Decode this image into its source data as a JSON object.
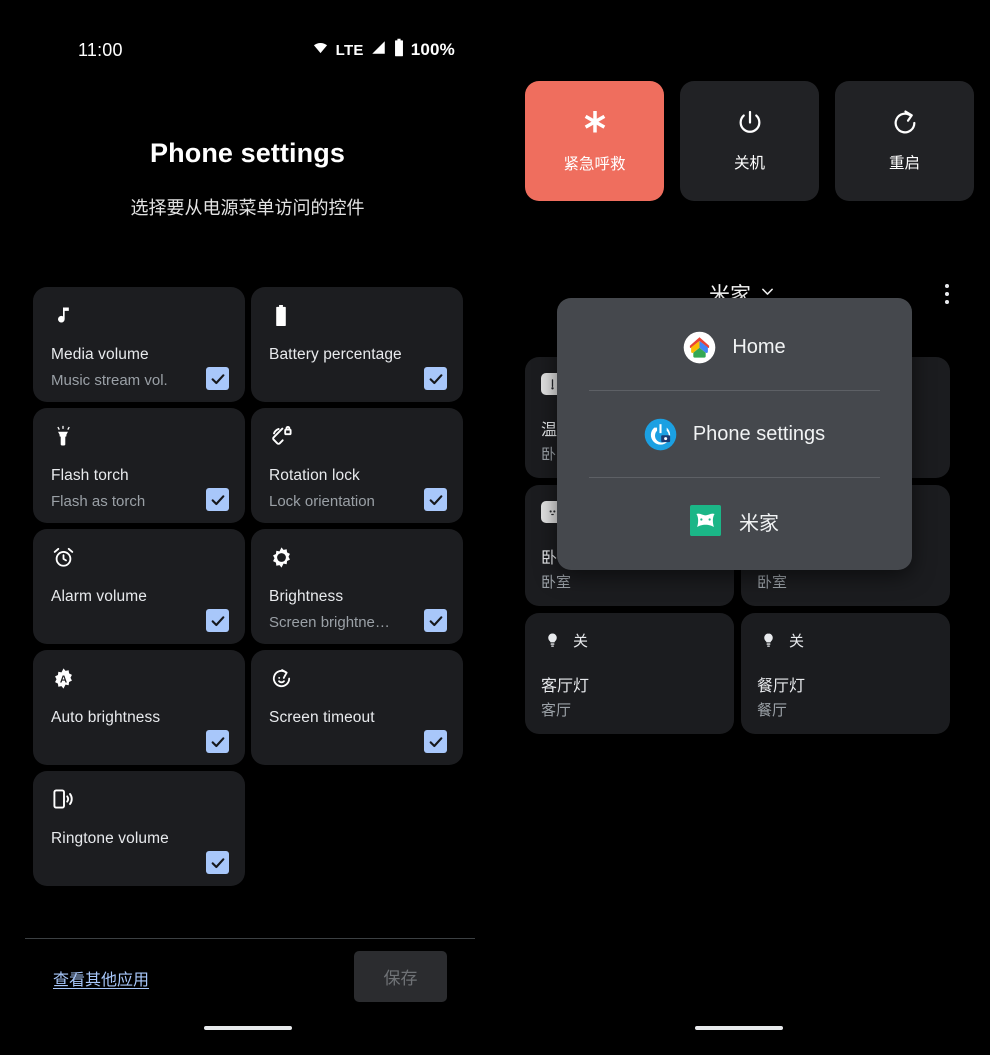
{
  "status_bar": {
    "time": "11:00",
    "network_label": "LTE",
    "battery_percent": "100%",
    "wifi_icon": "wifi-icon",
    "signal_icon": "signal-bars-icon",
    "battery_icon": "battery-full-icon"
  },
  "phone_settings": {
    "title": "Phone settings",
    "subtitle": "选择要从电源菜单访问的控件",
    "controls": [
      {
        "icon": "music-note-icon",
        "title": "Media volume",
        "subtitle": "Music stream vol.",
        "checked": true
      },
      {
        "icon": "battery-icon",
        "title": "Battery percentage",
        "subtitle": "",
        "checked": true
      },
      {
        "icon": "flashlight-icon",
        "title": "Flash torch",
        "subtitle": "Flash as torch",
        "checked": true
      },
      {
        "icon": "rotation-lock-icon",
        "title": "Rotation lock",
        "subtitle": "Lock orientation",
        "checked": true
      },
      {
        "icon": "alarm-clock-icon",
        "title": "Alarm volume",
        "subtitle": "",
        "checked": true
      },
      {
        "icon": "brightness-icon",
        "title": "Brightness",
        "subtitle": "Screen brightne…",
        "checked": true
      },
      {
        "icon": "auto-brightness-icon",
        "title": "Auto brightness",
        "subtitle": "",
        "checked": true
      },
      {
        "icon": "screen-timeout-icon",
        "title": "Screen timeout",
        "subtitle": "",
        "checked": true
      },
      {
        "icon": "ringtone-icon",
        "title": "Ringtone volume",
        "subtitle": "",
        "checked": true
      }
    ],
    "other_apps_link": "查看其他应用",
    "save_button": "保存"
  },
  "power_menu": {
    "buttons": [
      {
        "label": "紧急呼救",
        "icon": "star-of-life-icon",
        "accent": "#ef6e5e"
      },
      {
        "label": "关机",
        "icon": "power-icon",
        "accent": "#212225"
      },
      {
        "label": "重启",
        "icon": "restart-icon",
        "accent": "#212225"
      }
    ]
  },
  "home_controls": {
    "app_title": "米家",
    "chevron_icon": "chevron-down-icon",
    "overflow_icon": "kebab-menu-icon",
    "devices": [
      {
        "state": "",
        "name": "温",
        "room": "卧",
        "badge_icon": "thermometer-icon"
      },
      {
        "state": "",
        "name": "",
        "room": "",
        "badge_icon": ""
      },
      {
        "state": "",
        "name": "卧",
        "room": "卧室",
        "badge_icon": "outlet-icon"
      },
      {
        "state": "",
        "name": "",
        "room": "卧室",
        "badge_icon": ""
      },
      {
        "state": "关",
        "name": "客厅灯",
        "room": "客厅",
        "badge_icon": "bulb-icon"
      },
      {
        "state": "关",
        "name": "餐厅灯",
        "room": "餐厅",
        "badge_icon": "bulb-icon"
      }
    ]
  },
  "app_picker_popup": {
    "items": [
      {
        "label": "Home",
        "icon": "google-home-icon"
      },
      {
        "label": "Phone settings",
        "icon": "phone-settings-icon"
      },
      {
        "label": "米家",
        "icon": "mi-home-icon"
      }
    ]
  },
  "colors": {
    "background": "#000000",
    "card": "#1c1d20",
    "checkbox": "#a8c7fa",
    "emergency": "#ef6e5e",
    "popup": "#45484d",
    "link": "#a8c7fa",
    "mi_home_green": "#1bb687"
  }
}
